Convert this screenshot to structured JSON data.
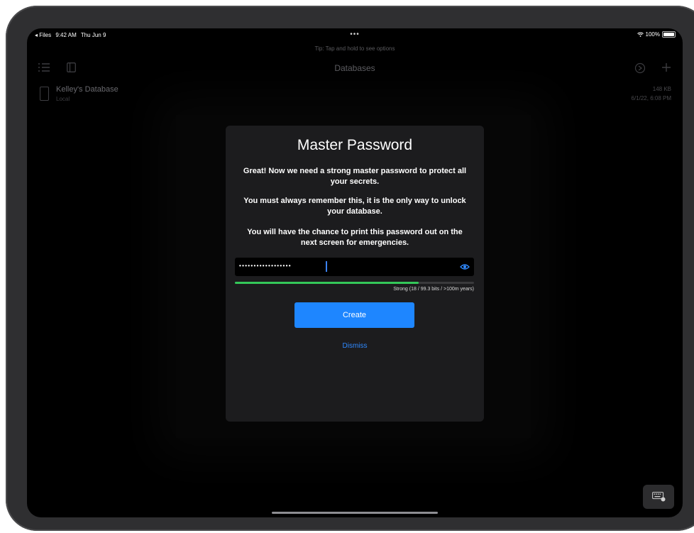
{
  "status_bar": {
    "back_app": "◂ Files",
    "time": "9:42 AM",
    "date": "Thu Jun 9",
    "dots": "•••",
    "wifi_icon": "wifi-icon",
    "battery": "100%"
  },
  "tip": "Tip: Tap and hold to see options",
  "nav": {
    "title": "Databases"
  },
  "database": {
    "name": "Kelley's Database",
    "location": "Local",
    "size": "148 KB",
    "modified": "6/1/22, 6:08 PM"
  },
  "modal": {
    "title": "Master Password",
    "paragraph1": "Great! Now we need a strong master password to protect all your secrets.",
    "paragraph2": "You must always remember this, it is the only way to unlock your database.",
    "paragraph3": "You will have the chance to print this password out on the next screen for emergencies.",
    "password_masked": "••••••••••••••••••",
    "strength_fraction": 0.77,
    "strength_color": "#34c759",
    "strength_label": "Strong (18 / 99.3 bits / >100m years)",
    "create_label": "Create",
    "dismiss_label": "Dismiss"
  },
  "accent_color": "#1e86ff"
}
